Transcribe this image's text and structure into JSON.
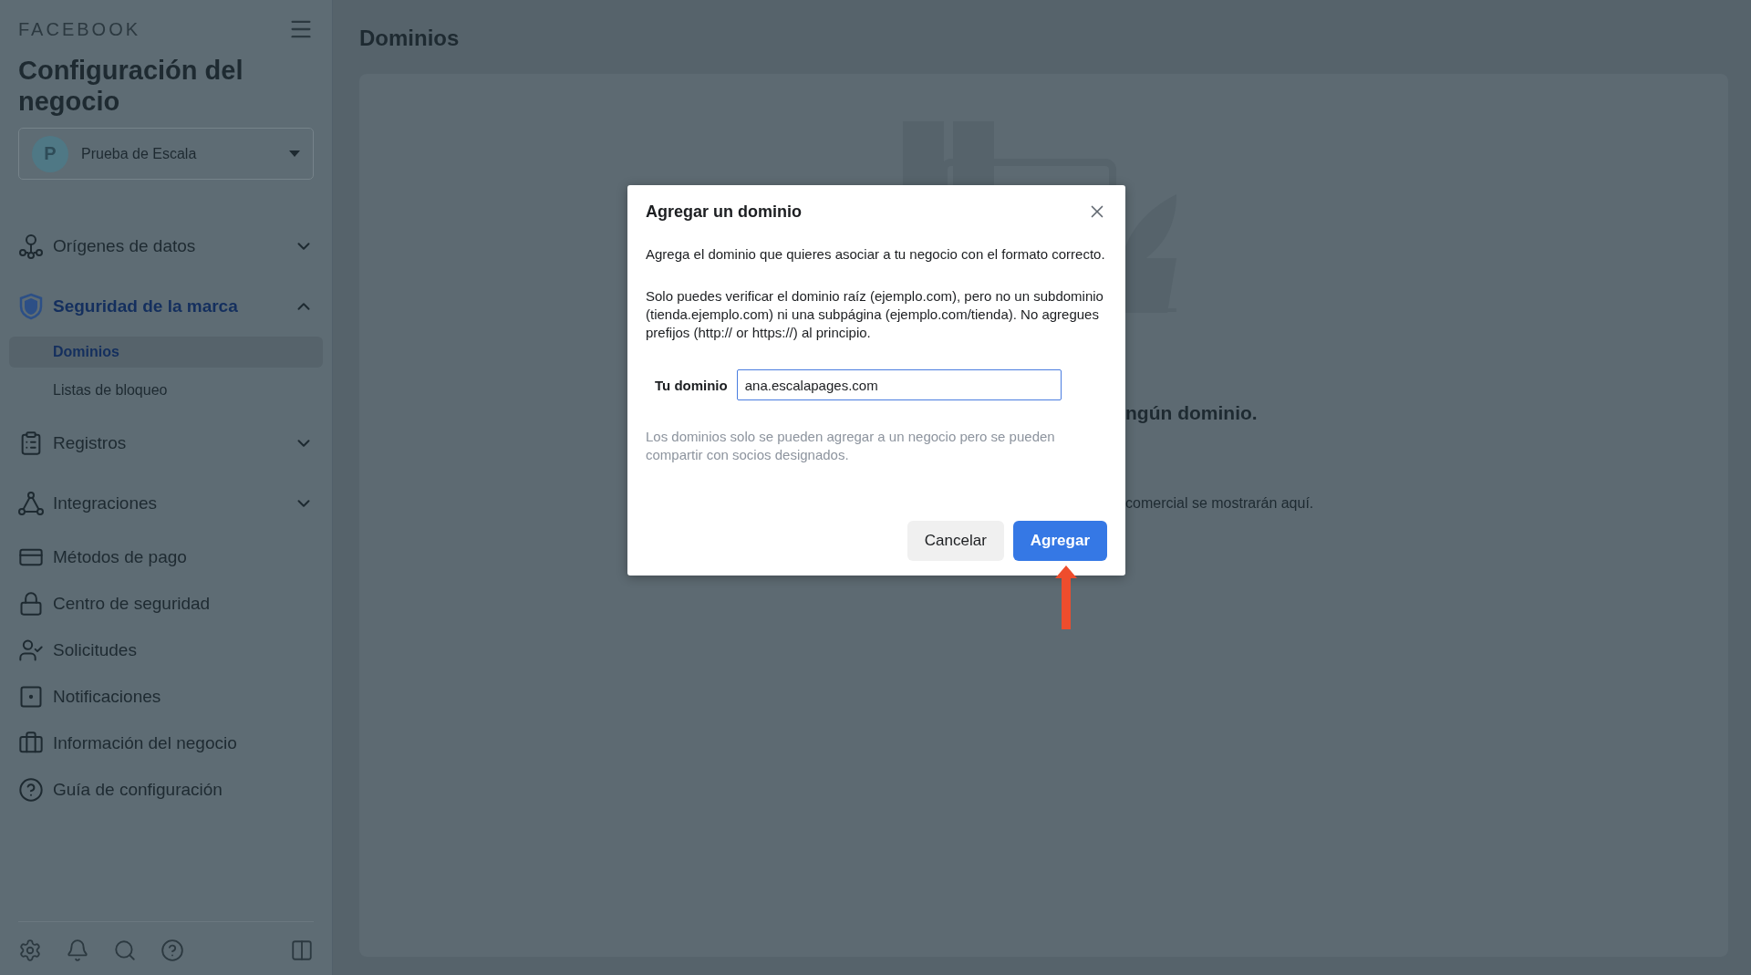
{
  "sidebar": {
    "brand": "FACEBOOK",
    "title": "Configuración del negocio",
    "account": {
      "initial": "P",
      "name": "Prueba de Escala"
    },
    "items": [
      {
        "kind": "group",
        "label": "Orígenes de datos",
        "selected": false,
        "expanded": false
      },
      {
        "kind": "group",
        "label": "Seguridad de la marca",
        "selected": true,
        "expanded": true,
        "children": [
          {
            "label": "Dominios",
            "selected": true
          },
          {
            "label": "Listas de bloqueo",
            "selected": false
          }
        ]
      },
      {
        "kind": "group",
        "label": "Registros",
        "selected": false,
        "expanded": false
      },
      {
        "kind": "group",
        "label": "Integraciones",
        "selected": false,
        "expanded": false
      },
      {
        "kind": "link",
        "label": "Métodos de pago",
        "selected": false
      },
      {
        "kind": "link",
        "label": "Centro de seguridad",
        "selected": false
      },
      {
        "kind": "link",
        "label": "Solicitudes",
        "selected": false
      },
      {
        "kind": "link",
        "label": "Notificaciones",
        "selected": false
      },
      {
        "kind": "link",
        "label": "Información del negocio",
        "selected": false
      },
      {
        "kind": "link",
        "label": "Guía de configuración",
        "selected": false
      }
    ]
  },
  "main": {
    "title": "Dominios",
    "empty_state": {
      "heading": "ngún dominio.",
      "description": "comercial se mostrarán aquí."
    }
  },
  "dialog": {
    "title": "Agregar un dominio",
    "paragraphs": [
      "Agrega el dominio que quieres asociar a tu negocio con el formato correcto.",
      "Solo puedes verificar el dominio raíz (ejemplo.com), pero no un subdominio (tienda.ejemplo.com) ni una subpágina (ejemplo.com/tienda). No agregues prefijos (http:// or https://) al principio."
    ],
    "field": {
      "label": "Tu dominio",
      "value": "ana.escalapages.com"
    },
    "note": "Los dominios solo se pueden agregar a un negocio pero se pueden compartir con socios designados.",
    "buttons": [
      {
        "label": "Cancelar",
        "kind": "secondary"
      },
      {
        "label": "Agregar",
        "kind": "primary"
      }
    ]
  }
}
